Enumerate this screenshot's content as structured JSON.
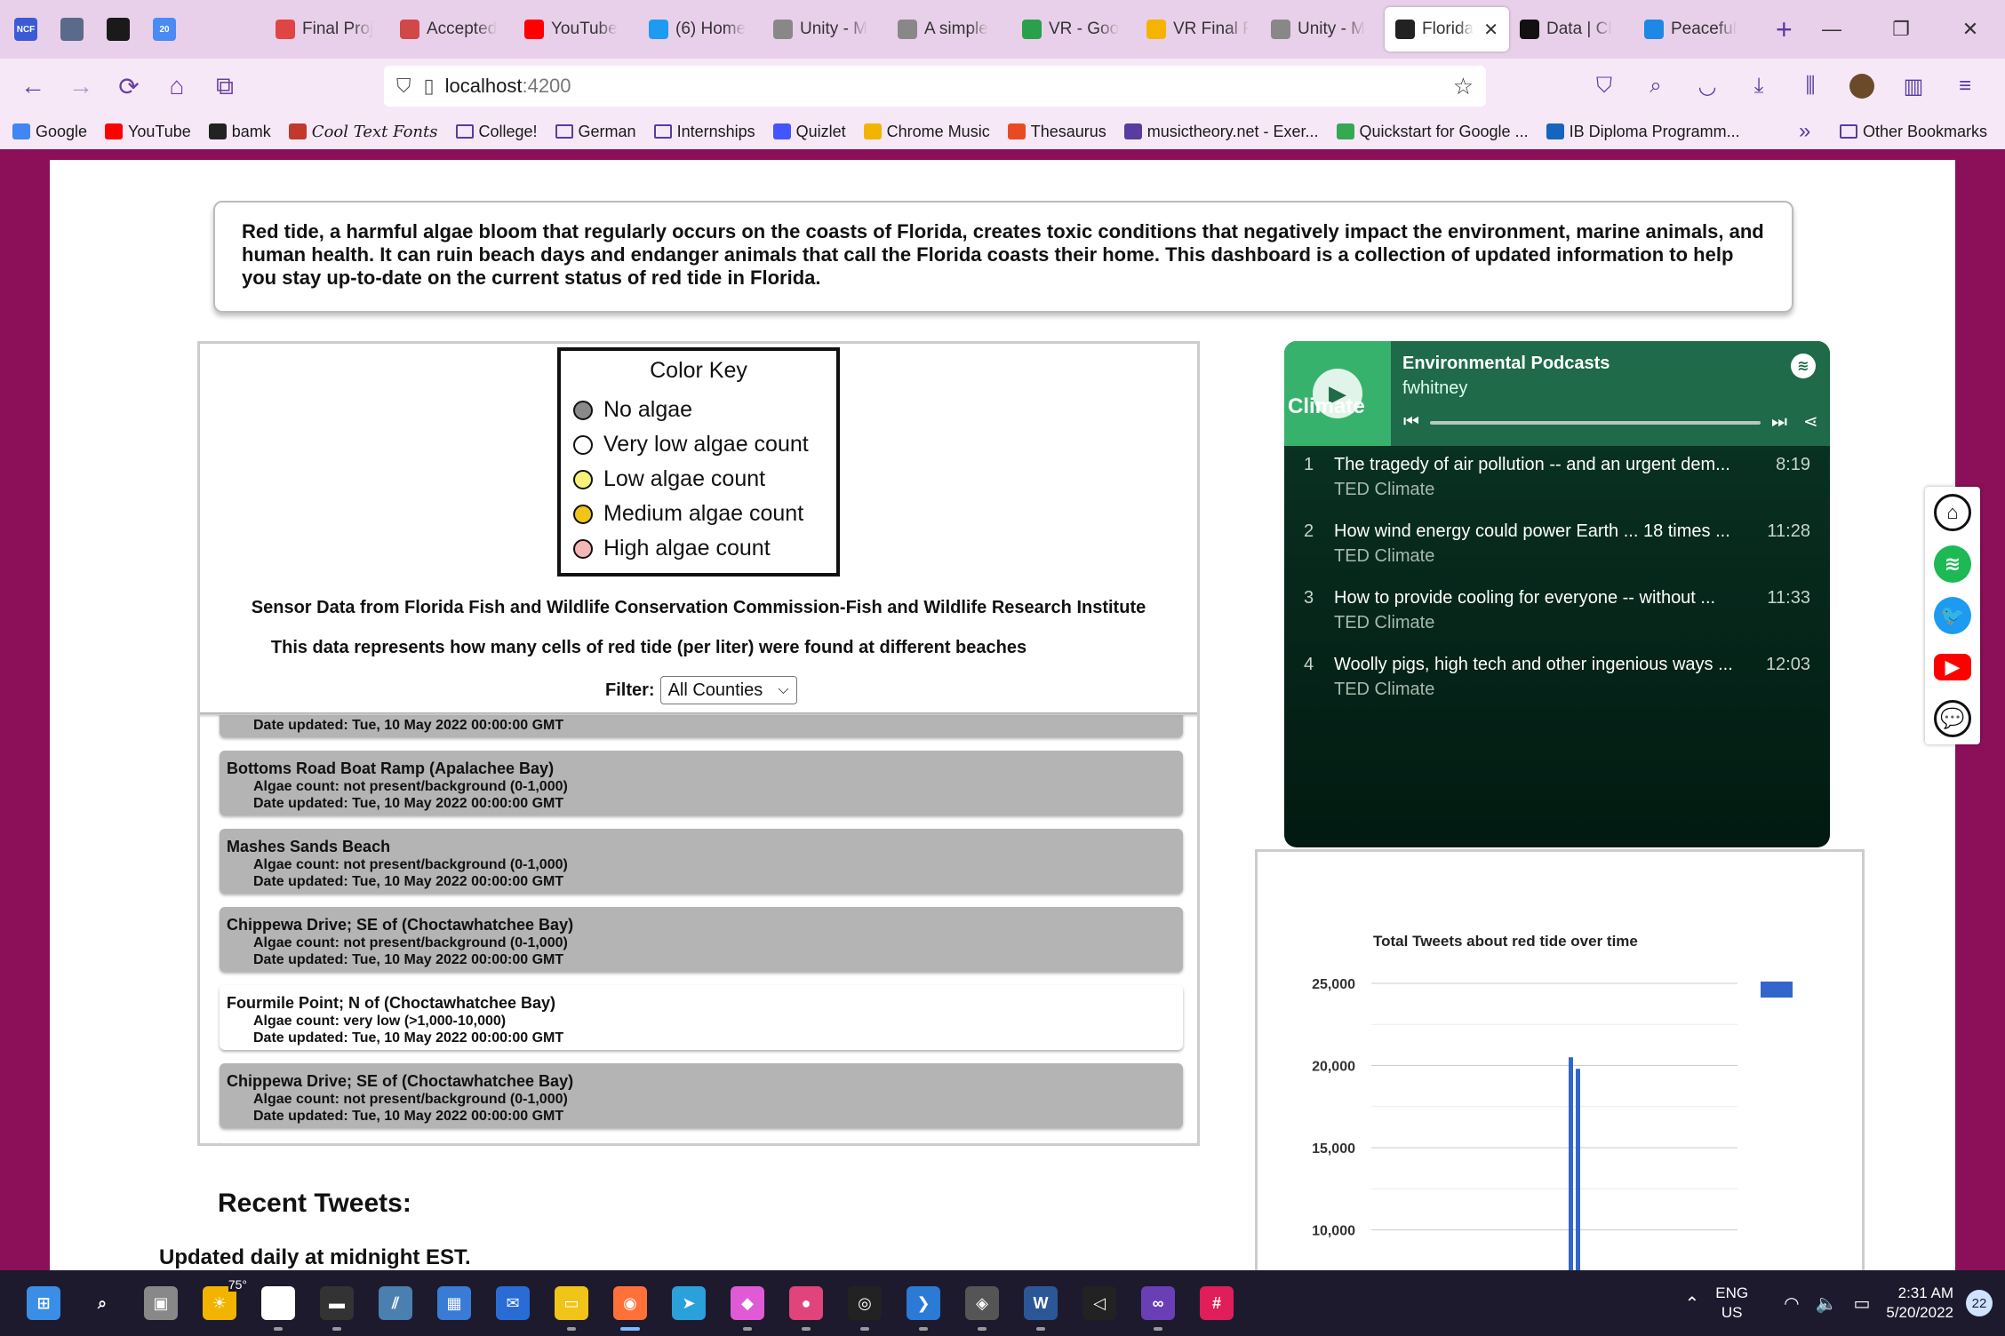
{
  "browser": {
    "pinned_tabs": [
      {
        "name": "ncf",
        "label": "NCF",
        "color": "#3b5bd6"
      },
      {
        "name": "trello-1",
        "label": "",
        "color": "#5a6a8a"
      },
      {
        "name": "trello-2",
        "label": "",
        "color": "#1a1a1a"
      },
      {
        "name": "calendar",
        "label": "20",
        "color": "#4a8af4"
      }
    ],
    "tabs": [
      {
        "label": "Final Proj",
        "icon": "circle-dashed-icon",
        "color": "#e04444"
      },
      {
        "label": "Accepted",
        "icon": "robot-icon",
        "color": "#d04848"
      },
      {
        "label": "YouTube",
        "icon": "youtube-icon",
        "color": "#ff0000"
      },
      {
        "label": "(6) Home",
        "icon": "twitter-icon",
        "color": "#1d9bf0"
      },
      {
        "label": "Unity - M",
        "icon": "unity-icon",
        "color": "#888888"
      },
      {
        "label": "A simple",
        "icon": "unity-icon",
        "color": "#888888"
      },
      {
        "label": "VR - Goo",
        "icon": "drive-icon",
        "color": "#2aa04a"
      },
      {
        "label": "VR Final F",
        "icon": "slides-icon",
        "color": "#f4b400"
      },
      {
        "label": "Unity - M",
        "icon": "unity-icon",
        "color": "#888888"
      },
      {
        "label": "Florida",
        "icon": "angular-icon",
        "color": "#222222",
        "active": true
      },
      {
        "label": "Data | Cl",
        "icon": "leaf-icon",
        "color": "#111111"
      },
      {
        "label": "Peaceful",
        "icon": "play-icon",
        "color": "#1e88e5"
      }
    ],
    "url_host": "localhost",
    "url_port": ":4200",
    "bookmarks": [
      {
        "label": "Google",
        "icon": "google-icon",
        "color": "#4285f4"
      },
      {
        "label": "YouTube",
        "icon": "youtube-icon",
        "color": "#ff0000"
      },
      {
        "label": "bamk",
        "icon": "bamk-icon",
        "color": "#222222"
      },
      {
        "label": "Cool Text Fonts",
        "icon": "ctf-icon",
        "color": "#c0392b",
        "cool": true
      },
      {
        "label": "College!",
        "icon": "folder-icon",
        "folder": true
      },
      {
        "label": "German",
        "icon": "folder-icon",
        "folder": true
      },
      {
        "label": "Internships",
        "icon": "folder-icon",
        "folder": true
      },
      {
        "label": "Quizlet",
        "icon": "quizlet-icon",
        "color": "#4255ff"
      },
      {
        "label": "Chrome Music",
        "icon": "chrome-music-icon",
        "color": "#f2b400"
      },
      {
        "label": "Thesaurus",
        "icon": "thesaurus-icon",
        "color": "#e84b23"
      },
      {
        "label": "musictheory.net - Exer...",
        "icon": "globe-icon",
        "color": "#5a3b9f"
      },
      {
        "label": "Quickstart for Google ...",
        "icon": "code-icon",
        "color": "#34a853"
      },
      {
        "label": "IB Diploma Programm...",
        "icon": "ib-icon",
        "color": "#1565c0"
      }
    ],
    "overflow": "»",
    "other_bookmarks": "Other Bookmarks"
  },
  "intro_text": "Red tide, a harmful algae bloom that regularly occurs on the coasts of Florida, creates toxic conditions that negatively impact the environment, marine animals, and human health. It can ruin beach days and endanger animals that call the Florida coasts their home. This dashboard is a collection of updated information to help you stay up-to-date on the current status of red tide in Florida.",
  "color_key": {
    "title": "Color Key",
    "items": [
      {
        "label": "No algae",
        "color": "#8a8a8a"
      },
      {
        "label": "Very low algae count",
        "color": "#ffffff"
      },
      {
        "label": "Low algae count",
        "color": "#f7f07a"
      },
      {
        "label": "Medium algae count",
        "color": "#f0c419"
      },
      {
        "label": "High algae count",
        "color": "#f4b6b6"
      }
    ]
  },
  "source_text": "Sensor Data from Florida Fish and Wildlife Conservation Commission-Fish and Wildlife Research Institute",
  "represents_text": "This data represents how many cells of red tide (per liter) were found at different beaches",
  "filter": {
    "label": "Filter:",
    "value": "All Counties"
  },
  "sites": [
    {
      "name": "",
      "count": "",
      "date": "Date updated: Tue, 10 May 2022 00:00:00 GMT",
      "level": "none",
      "partial": true
    },
    {
      "name": "Bottoms Road Boat Ramp (Apalachee Bay)",
      "count": "Algae count: not present/background (0-1,000)",
      "date": "Date updated: Tue, 10 May 2022 00:00:00 GMT",
      "level": "none"
    },
    {
      "name": "Mashes Sands Beach",
      "count": "Algae count: not present/background (0-1,000)",
      "date": "Date updated: Tue, 10 May 2022 00:00:00 GMT",
      "level": "none"
    },
    {
      "name": "Chippewa Drive; SE of (Choctawhatchee Bay)",
      "count": "Algae count: not present/background (0-1,000)",
      "date": "Date updated: Tue, 10 May 2022 00:00:00 GMT",
      "level": "none"
    },
    {
      "name": "Fourmile Point; N of (Choctawhatchee Bay)",
      "count": "Algae count: very low (>1,000-10,000)",
      "date": "Date updated: Tue, 10 May 2022 00:00:00 GMT",
      "level": "very-low"
    },
    {
      "name": "Chippewa Drive; SE of (Choctawhatchee Bay)",
      "count": "Algae count: not present/background (0-1,000)",
      "date": "Date updated: Tue, 10 May 2022 00:00:00 GMT",
      "level": "none"
    }
  ],
  "recent_tweets_heading": "Recent Tweets:",
  "updated_daily": "Updated daily at midnight EST.",
  "podcast": {
    "title": "Environmental Podcasts",
    "author": "fwhitney",
    "cover_text": "Climate",
    "episodes": [
      {
        "num": "1",
        "title": "The tragedy of air pollution -- and an urgent dem...",
        "show": "TED Climate",
        "duration": "8:19"
      },
      {
        "num": "2",
        "title": "How wind energy could power Earth ... 18 times ...",
        "show": "TED Climate",
        "duration": "11:28"
      },
      {
        "num": "3",
        "title": "How to provide cooling for everyone -- without ...",
        "show": "TED Climate",
        "duration": "11:33"
      },
      {
        "num": "4",
        "title": "Woolly pigs, high tech and other ingenious ways ...",
        "show": "TED Climate",
        "duration": "12:03"
      }
    ]
  },
  "chart_data": {
    "type": "bar",
    "title": "Total Tweets about red tide over time",
    "ylim": [
      10000,
      25000
    ],
    "yticks": [
      {
        "value": 25000,
        "label": "25,000"
      },
      {
        "value": 20000,
        "label": "20,000"
      },
      {
        "value": 15000,
        "label": "15,000"
      },
      {
        "value": 10000,
        "label": "10,000"
      }
    ],
    "series_color": "#3366cc",
    "values": [
      20500,
      19800
    ],
    "legend": "right",
    "grid": true
  },
  "social": [
    "home-icon",
    "spotify-icon",
    "twitter-icon",
    "youtube-icon",
    "chat-icon"
  ],
  "taskbar": {
    "weather": "75°",
    "lang_top": "ENG",
    "lang_bottom": "US",
    "time": "2:31 AM",
    "date": "5/20/2022",
    "notifications": "22"
  }
}
